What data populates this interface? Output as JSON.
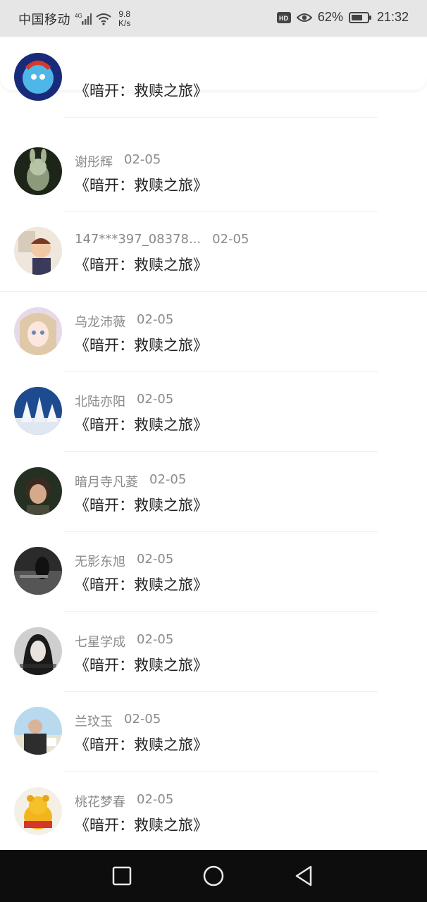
{
  "status_bar": {
    "carrier": "中国移动",
    "network": "4G",
    "speed_value": "9.8",
    "speed_unit": "K/s",
    "hd": "HD",
    "battery_percent": "62%",
    "time": "21:32"
  },
  "colors": {
    "accent": "#2a90e8",
    "meta_text": "#8a8a8a",
    "title_text": "#222222"
  },
  "list": {
    "items": [
      {
        "name": "",
        "date": "",
        "title": "《暗开：救赎之旅》"
      },
      {
        "name": "谢彤辉",
        "date": "02-05",
        "title": "《暗开：救赎之旅》"
      },
      {
        "name": "147***397_08378...",
        "date": "02-05",
        "title": "《暗开：救赎之旅》"
      },
      {
        "name": "乌龙沛薇",
        "date": "02-05",
        "title": "《暗开：救赎之旅》"
      },
      {
        "name": "北陆亦阳",
        "date": "02-05",
        "title": "《暗开：救赎之旅》"
      },
      {
        "name": "暗月寺凡菱",
        "date": "02-05",
        "title": "《暗开：救赎之旅》"
      },
      {
        "name": "无影东旭",
        "date": "02-05",
        "title": "《暗开：救赎之旅》"
      },
      {
        "name": "七星学成",
        "date": "02-05",
        "title": "《暗开：救赎之旅》"
      },
      {
        "name": "兰玟玉",
        "date": "02-05",
        "title": "《暗开：救赎之旅》"
      },
      {
        "name": "桃花梦春",
        "date": "02-05",
        "title": "《暗开：救赎之旅》"
      }
    ]
  }
}
